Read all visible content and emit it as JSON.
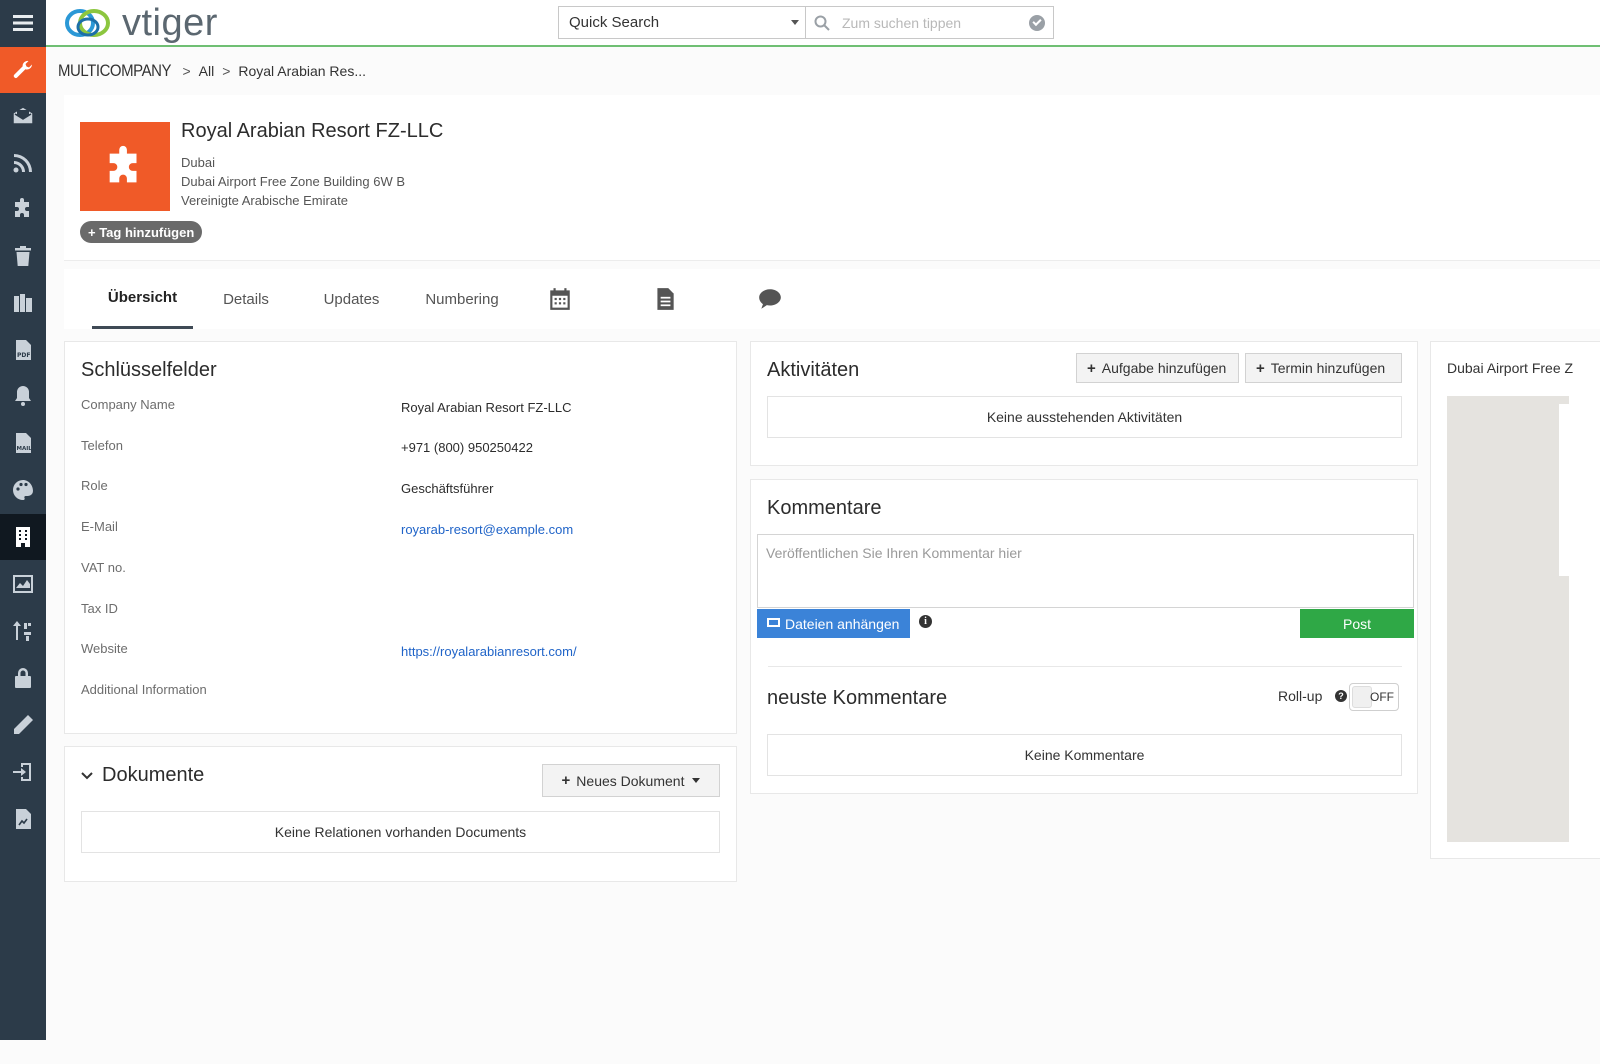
{
  "app": {
    "logo_text": "vtiger",
    "colors": {
      "accent_orange": "#f05a28",
      "sidebar": "#2c3b49",
      "link": "#2064c8",
      "post_green": "#2fa846",
      "attach_blue": "#3b83d8"
    }
  },
  "sidebar": {
    "items": [
      {
        "name": "menu",
        "icon": "hamburger-icon"
      },
      {
        "name": "settings",
        "icon": "wrench-icon"
      },
      {
        "name": "mail",
        "icon": "mail-icon"
      },
      {
        "name": "rss",
        "icon": "rss-icon"
      },
      {
        "name": "extensions",
        "icon": "puzzle-icon"
      },
      {
        "name": "recycle-bin",
        "icon": "trash-icon"
      },
      {
        "name": "books",
        "icon": "books-icon"
      },
      {
        "name": "pdf",
        "icon": "pdf-icon"
      },
      {
        "name": "notifications",
        "icon": "bell-icon"
      },
      {
        "name": "mail-templates",
        "icon": "mail-doc-icon"
      },
      {
        "name": "themes",
        "icon": "palette-icon"
      },
      {
        "name": "multicompany",
        "icon": "building-icon"
      },
      {
        "name": "reports",
        "icon": "chart-icon"
      },
      {
        "name": "sort",
        "icon": "sort-icon"
      },
      {
        "name": "security",
        "icon": "lock-icon"
      },
      {
        "name": "edit",
        "icon": "pencil-icon"
      },
      {
        "name": "import",
        "icon": "import-icon"
      },
      {
        "name": "documents",
        "icon": "doc-chart-icon"
      }
    ]
  },
  "search": {
    "select_value": "Quick Search",
    "placeholder": "Zum suchen tippen"
  },
  "breadcrumb": {
    "module": "MULTICOMPANY",
    "sep": ">",
    "filter": "All",
    "record": "Royal Arabian Res..."
  },
  "record": {
    "title": "Royal Arabian Resort FZ-LLC",
    "city": "Dubai",
    "street": "Dubai Airport Free Zone Building 6W B",
    "country": "Vereinigte Arabische Emirate",
    "tag_button": "+ Tag hinzufügen"
  },
  "tabs": {
    "overview": "Übersicht",
    "details": "Details",
    "updates": "Updates",
    "numbering": "Numbering"
  },
  "key_fields": {
    "title": "Schlüsselfelder",
    "rows": [
      {
        "label": "Company Name",
        "value": "Royal Arabian Resort FZ-LLC"
      },
      {
        "label": "Telefon",
        "value": "+971 (800) 950250422"
      },
      {
        "label": "Role",
        "value": "Geschäftsführer"
      },
      {
        "label": "E-Mail",
        "value": "royarab-resort@example.com"
      },
      {
        "label": "VAT no.",
        "value": ""
      },
      {
        "label": "Tax ID",
        "value": ""
      },
      {
        "label": "Website",
        "value": "https://royalarabianresort.com/"
      },
      {
        "label": "Additional Information",
        "value": ""
      }
    ]
  },
  "documents": {
    "title": "Dokumente",
    "new_button": "Neues Dokument",
    "empty": "Keine Relationen vorhanden Documents"
  },
  "activities": {
    "title": "Aktivitäten",
    "add_task": "Aufgabe hinzufügen",
    "add_event": "Termin hinzufügen",
    "empty": "Keine ausstehenden Aktivitäten"
  },
  "comments": {
    "title": "Kommentare",
    "placeholder": "Veröffentlichen Sie Ihren Kommentar hier",
    "attach": "Dateien anhängen",
    "post": "Post",
    "recent_title": "neuste Kommentare",
    "rollup_label": "Roll-up",
    "rollup_state": "OFF",
    "empty": "Keine Kommentare"
  },
  "map": {
    "title": "Dubai Airport Free Z"
  }
}
